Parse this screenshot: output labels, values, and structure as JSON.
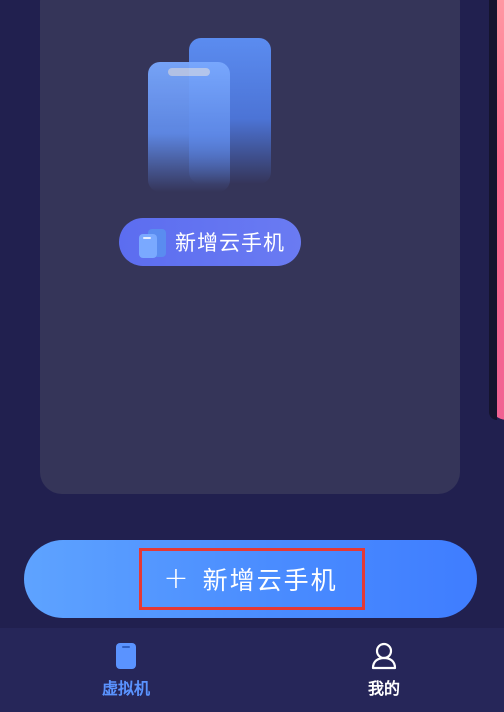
{
  "colors": {
    "background": "#21204f",
    "card": "#353559",
    "accent": "#4a8cff",
    "tab_active": "#5a93ff",
    "highlight_border": "#e53935"
  },
  "device_card": {
    "illustration_icon": "phone-stack-icon",
    "pill_button": {
      "icon": "phone-stack-icon",
      "label": "新增云手机"
    }
  },
  "main_action": {
    "icon": "plus-icon",
    "plus_glyph": "+",
    "label": "新增云手机"
  },
  "tab_bar": {
    "tabs": [
      {
        "label": "虚拟机",
        "icon": "phone-icon",
        "active": true
      },
      {
        "label": "我的",
        "icon": "user-icon",
        "active": false
      }
    ]
  }
}
